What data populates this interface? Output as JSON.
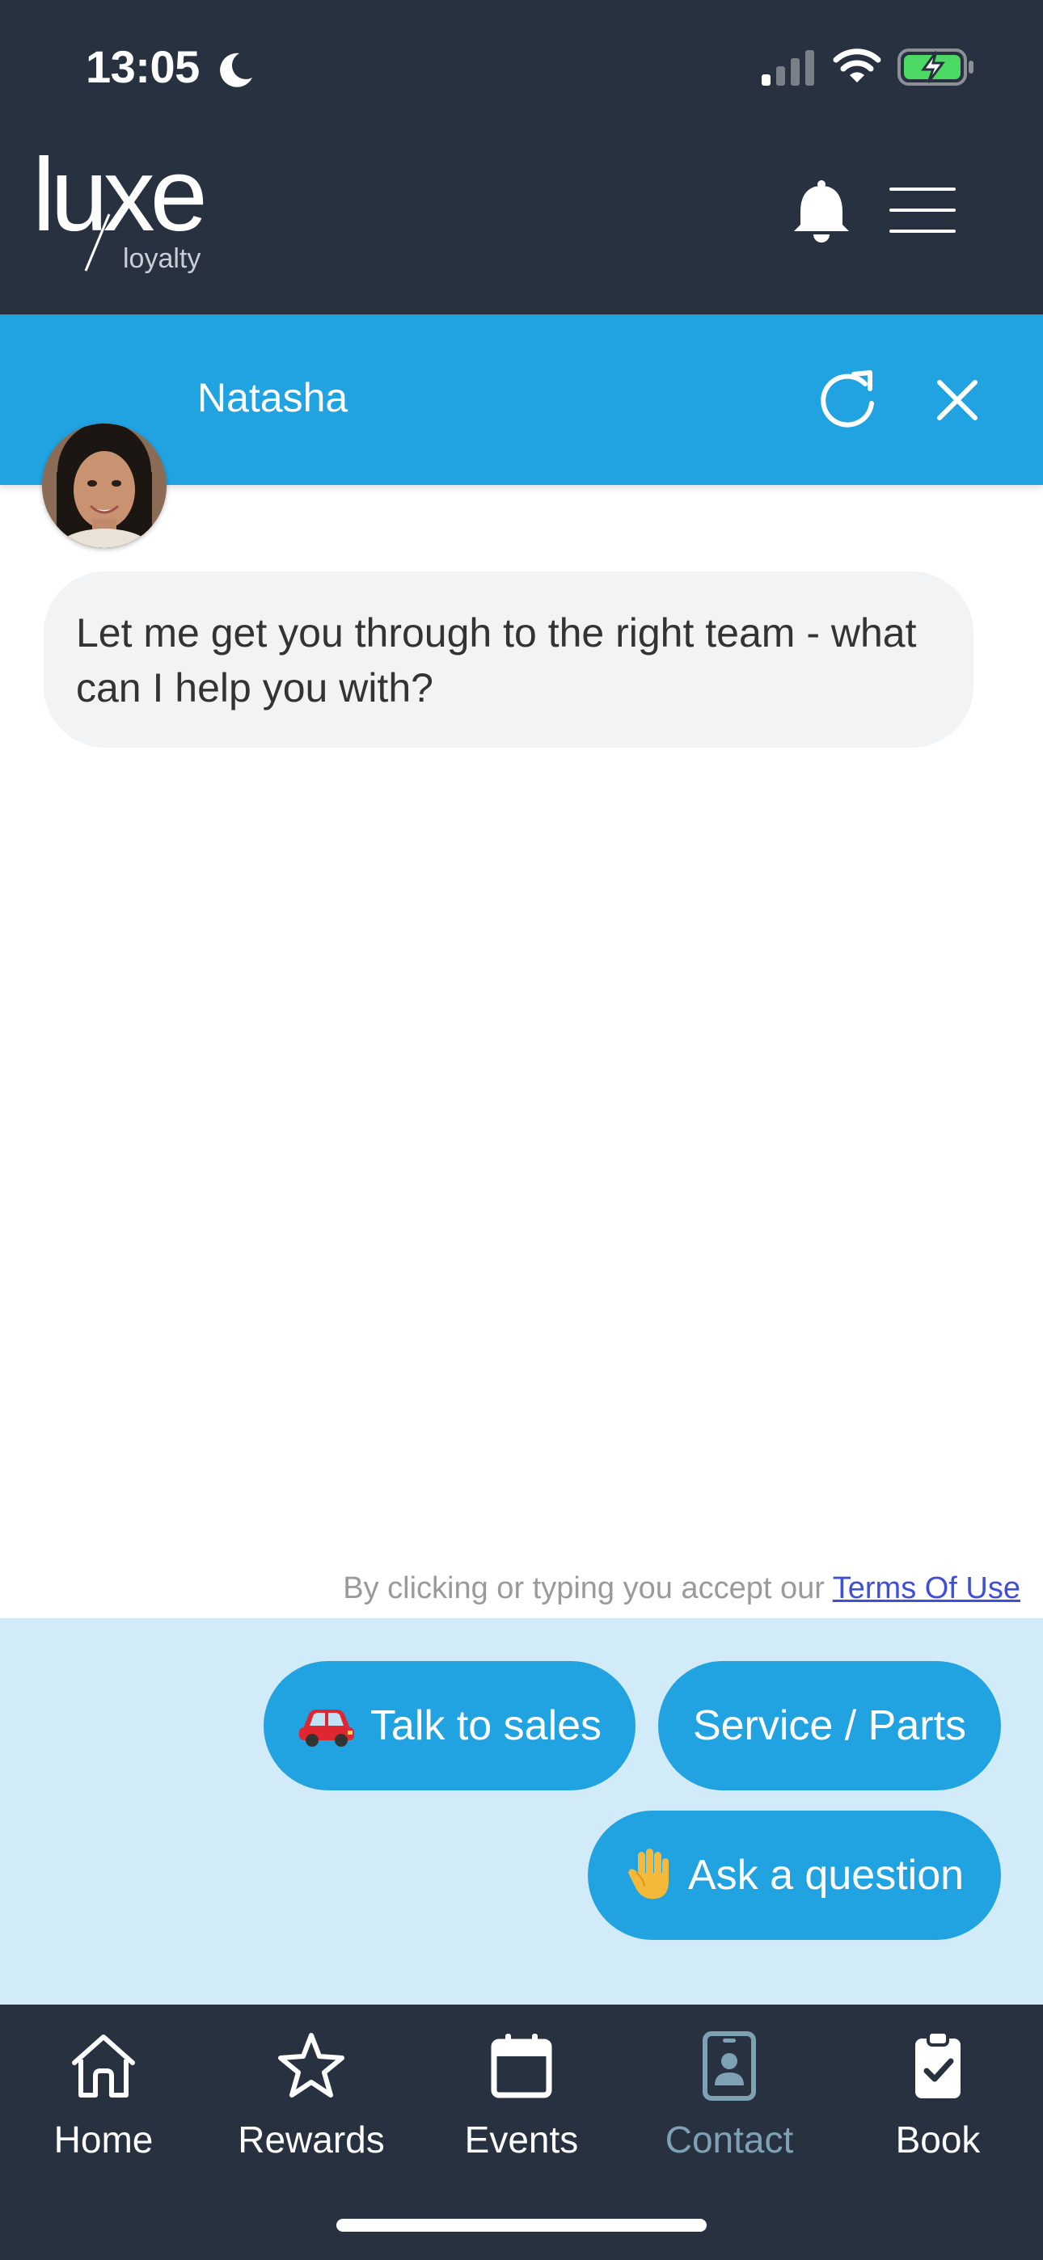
{
  "status_bar": {
    "time": "13:05",
    "icons": [
      "moon-icon",
      "signal-icon",
      "wifi-icon",
      "battery-charging-icon"
    ]
  },
  "app_header": {
    "logo_primary": "luxe",
    "logo_secondary": "loyalty",
    "icons": [
      "bell-icon",
      "hamburger-menu-icon"
    ]
  },
  "chat": {
    "agent_name": "Natasha",
    "header_icons": [
      "refresh-icon",
      "close-icon"
    ],
    "messages": [
      {
        "from": "agent",
        "text": "Let me get you through to the right team - what can I help you with?"
      }
    ],
    "terms_prefix": "By clicking or typing you accept our ",
    "terms_link": "Terms Of Use",
    "quick_replies": [
      {
        "label": "Talk to sales",
        "icon": "car-icon"
      },
      {
        "label": "Service / Parts"
      },
      {
        "label": "Ask a question",
        "icon": "raised-hand-icon"
      }
    ]
  },
  "bottom_nav": {
    "items": [
      {
        "label": "Home",
        "icon": "home-icon"
      },
      {
        "label": "Rewards",
        "icon": "star-icon"
      },
      {
        "label": "Events",
        "icon": "calendar-icon"
      },
      {
        "label": "Contact",
        "icon": "contact-card-icon",
        "active": true
      },
      {
        "label": "Book",
        "icon": "clipboard-check-icon"
      }
    ],
    "active_color": "#7fa1b4"
  },
  "colors": {
    "header_bg": "#283140",
    "accent": "#22a3e1",
    "quick_reply_area": "#d2ebf8",
    "bubble_bg": "#f2f3f5"
  }
}
